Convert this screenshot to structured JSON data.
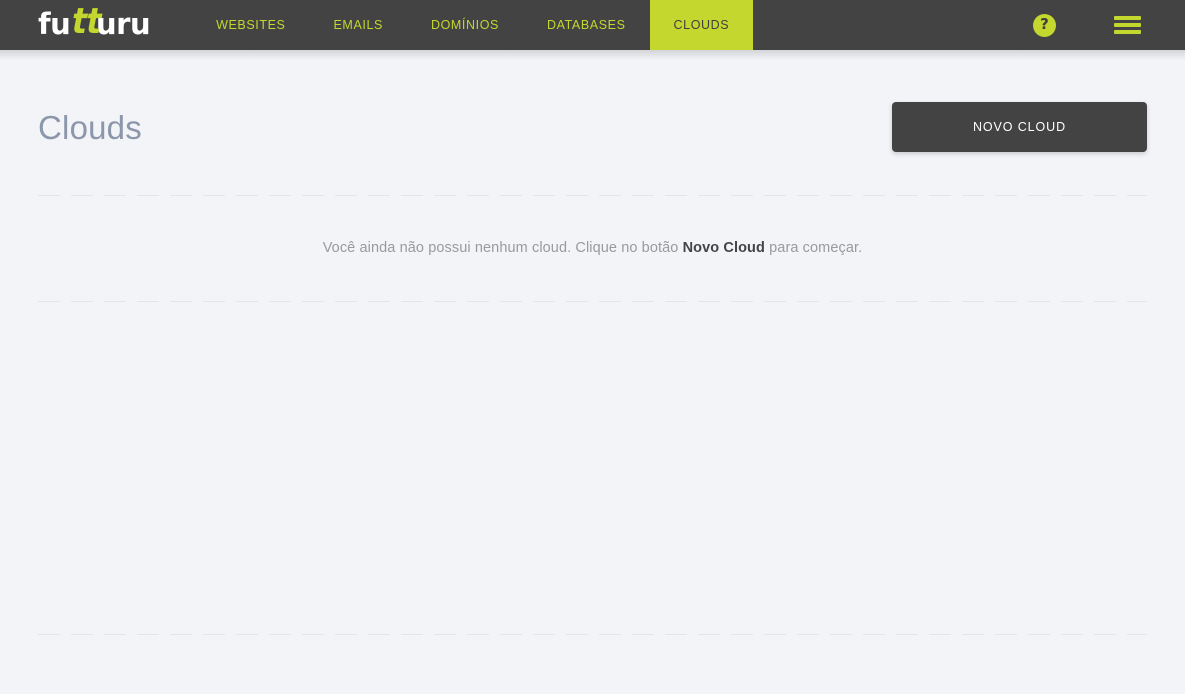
{
  "brand": {
    "name_part1": "fu",
    "name_accent": "tt",
    "name_part2": "uru"
  },
  "header": {
    "nav_items": [
      {
        "label": "WEBSITES",
        "active": false
      },
      {
        "label": "EMAILS",
        "active": false
      },
      {
        "label": "DOMÍNIOS",
        "active": false
      },
      {
        "label": "DATABASES",
        "active": false
      },
      {
        "label": "CLOUDS",
        "active": true
      }
    ],
    "help_label": "?",
    "menu_label": "menu",
    "background_color": "#434343",
    "accent_color": "#c3d72e"
  },
  "main": {
    "page_title": "Clouds",
    "new_cloud_button": "NOVO CLOUD",
    "empty_state": {
      "text_before": "Você ainda não possui nenhum cloud. Clique no botão",
      "highlight": "Novo Cloud",
      "text_after": "para começar."
    }
  }
}
